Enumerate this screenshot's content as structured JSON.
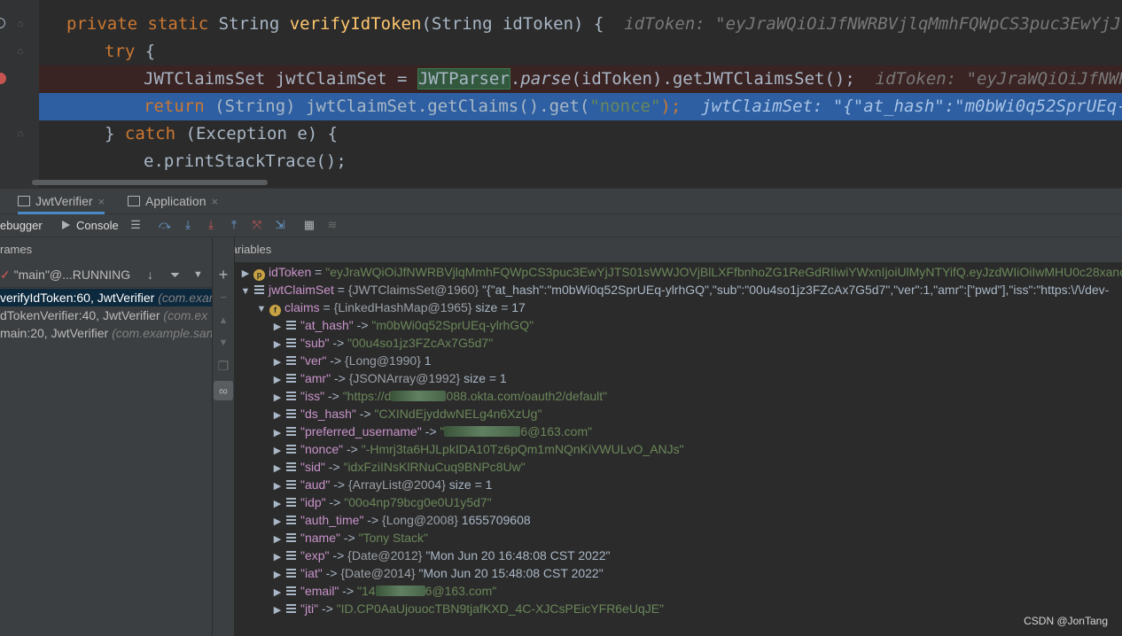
{
  "editor": {
    "line1": {
      "kw1": "private",
      "kw2": "static",
      "type": "String",
      "method": "verifyIdToken",
      "params": "(String idToken) {",
      "hint": "idToken: \"eyJraWQiOiJfNWRBVjlqMmhFQWpCS3puc3EwYjJTS01sW"
    },
    "line2": {
      "kw": "try",
      "rest": " {"
    },
    "line3": {
      "decl": "JWTClaimsSet jwtClaimSet = ",
      "cls": "JWTParser",
      "dot": ".",
      "call": "parse",
      "rest": "(idToken).getJWTClaimsSet();",
      "hint": "idToken: \"eyJraWQiOiJfNWRBVjlq"
    },
    "line4": {
      "kw": "return",
      "mid": " (String) jwtClaimSet.getClaims().get(",
      "str": "\"nonce\"",
      "end": ");",
      "hint": "jwtClaimSet: \"{\"at_hash\":\"m0bWi0q52SprUEq-ylrhG"
    },
    "line5": {
      "open": "} ",
      "kw": "catch",
      "rest": " (Exception e) {"
    },
    "line6": {
      "text": "e.printStackTrace();"
    }
  },
  "tabs": [
    {
      "label": "JwtVerifier",
      "close": "×"
    },
    {
      "label": "Application",
      "close": "×"
    }
  ],
  "debugger": {
    "debugger_tab": "ebugger",
    "console_tab": "Console"
  },
  "frames": {
    "header": "rames",
    "thread": "\"main\"@...RUNNING",
    "items": [
      {
        "method": "verifyIdToken:60, JwtVerifier",
        "pkg": "(com.exam"
      },
      {
        "method": "dTokenVerifier:40, JwtVerifier",
        "pkg": "(com.ex"
      },
      {
        "method": "main:20, JwtVerifier",
        "pkg": "(com.example.san"
      }
    ]
  },
  "variables": {
    "header": "Variables",
    "idToken": {
      "name": "idToken",
      "value": "\"eyJraWQiOiJfNWRBVjlqMmhFQWpCS3puc3EwYjJTS01sWWJOVjBlLXFfbnhoZG1ReGdRIiwiYWxnIjoiUlMyNTYifQ.eyJzdWIiOiIwMHU0c28xanozRlpjQ"
    },
    "jwtClaimSet": {
      "name": "jwtClaimSet",
      "type": "{JWTClaimsSet@1960}",
      "value": "\"{\"at_hash\":\"m0bWi0q52SprUEq-ylrhGQ\",\"sub\":\"00u4so1jz3FZcAx7G5d7\",\"ver\":1,\"amr\":[\"pwd\"],\"iss\":\"https:\\/\\/dev-"
    },
    "claims": {
      "name": "claims",
      "type": "{LinkedHashMap@1965}",
      "size": "size = 17"
    },
    "entries": [
      {
        "key": "\"at_hash\"",
        "type": "",
        "value": "\"m0bWi0q52SprUEq-ylrhGQ\"",
        "str": true
      },
      {
        "key": "\"sub\"",
        "type": "",
        "value": "\"00u4so1jz3FZcAx7G5d7\"",
        "str": true
      },
      {
        "key": "\"ver\"",
        "type": "{Long@1990}",
        "value": "1",
        "str": false
      },
      {
        "key": "\"amr\"",
        "type": "{JSONArray@1992}",
        "value": "size = 1",
        "str": false
      },
      {
        "key": "\"iss\"",
        "type": "",
        "value": "\"https://d",
        "value2": "088.okta.com/oauth2/default\"",
        "str": true
      },
      {
        "key": "\"ds_hash\"",
        "type": "",
        "value": "\"CXINdEjyddwNELg4n6XzUg\"",
        "str": true
      },
      {
        "key": "\"preferred_username\"",
        "type": "",
        "value": "\"",
        "value2": "6@163.com\"",
        "str": true
      },
      {
        "key": "\"nonce\"",
        "type": "",
        "value": "\"-Hmrj3ta6HJLpkIDA10Tz6pQm1mNQnKiVWULvO_ANJs\"",
        "str": true
      },
      {
        "key": "\"sid\"",
        "type": "",
        "value": "\"idxFziINsKlRNuCuq9BNPc8Uw\"",
        "str": true
      },
      {
        "key": "\"aud\"",
        "type": "{ArrayList@2004}",
        "value": "size = 1",
        "str": false
      },
      {
        "key": "\"idp\"",
        "type": "",
        "value": "\"00o4np79bcg0e0U1y5d7\"",
        "str": true
      },
      {
        "key": "\"auth_time\"",
        "type": "{Long@2008}",
        "value": "1655709608",
        "str": false
      },
      {
        "key": "\"name\"",
        "type": "",
        "value": "\"Tony Stack\"",
        "str": true
      },
      {
        "key": "\"exp\"",
        "type": "{Date@2012}",
        "value": "\"Mon Jun 20 16:48:08 CST 2022\"",
        "str": false
      },
      {
        "key": "\"iat\"",
        "type": "{Date@2014}",
        "value": "\"Mon Jun 20 15:48:08 CST 2022\"",
        "str": false
      },
      {
        "key": "\"email\"",
        "type": "",
        "value": "\"14",
        "value2": "6@163.com\"",
        "str": true
      },
      {
        "key": "\"jti\"",
        "type": "",
        "value": "\"ID.CP0AaUjouocTBN9tjafKXD_4C-XJCsPEicYFR6eUqJE\"",
        "str": true
      }
    ]
  },
  "watermark": "CSDN @JonTang",
  "colors": {
    "accent": "#4a88c7",
    "exec_line": "#2d5fa2",
    "breakpoint": "#c75450"
  }
}
